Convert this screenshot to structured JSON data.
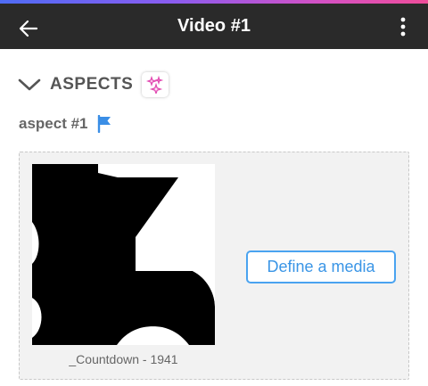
{
  "header": {
    "title": "Video #1",
    "back_icon": "arrow-left-icon",
    "menu_icon": "more-vertical-icon",
    "accent_gradient": [
      "#4f6cf5",
      "#8a5cf0",
      "#d451c4",
      "#ef4d9a"
    ]
  },
  "aspects": {
    "section_title": "ASPECTS",
    "collapse_icon": "chevron-down-icon",
    "sparkle_icon": "sparkle-icon",
    "item": {
      "label": "aspect #1",
      "flag_icon": "flag-icon",
      "flag_color": "#3a8ee6"
    }
  },
  "media": {
    "caption": "_Countdown - 1941",
    "define_button_label": "Define a media",
    "button_color": "#4aa3f0"
  }
}
